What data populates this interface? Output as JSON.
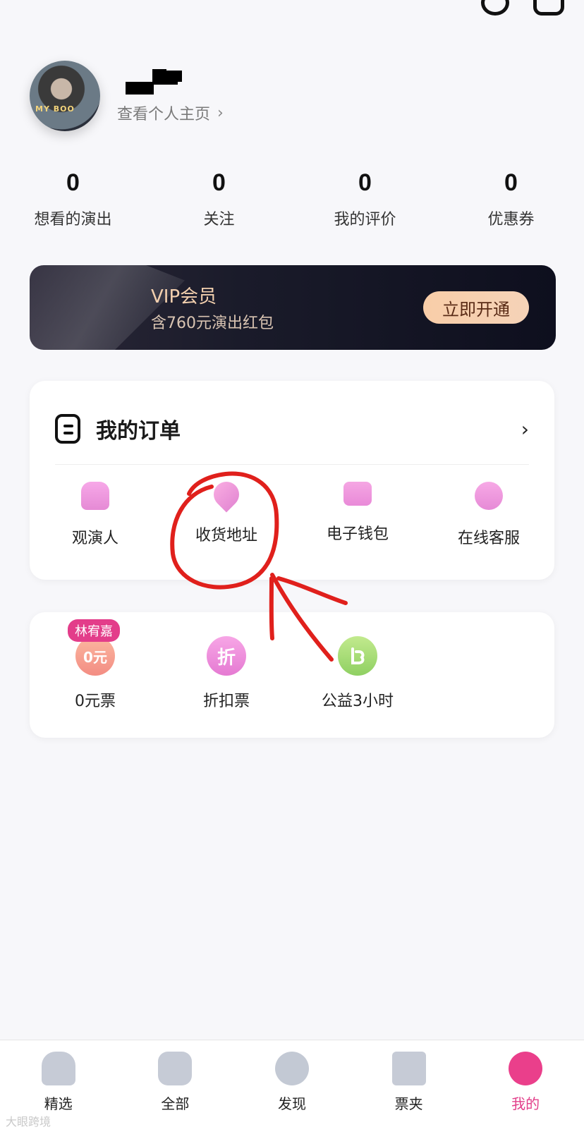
{
  "profile": {
    "view_home": "查看个人主页",
    "avatar_text": "MY BOO"
  },
  "stats": [
    {
      "value": "0",
      "label": "想看的演出"
    },
    {
      "value": "0",
      "label": "关注"
    },
    {
      "value": "0",
      "label": "我的评价"
    },
    {
      "value": "0",
      "label": "优惠券"
    }
  ],
  "vip": {
    "title": "VIP会员",
    "subtitle": "含760元演出红包",
    "button": "立即开通"
  },
  "orders": {
    "title": "我的订单",
    "items": [
      {
        "label": "观演人",
        "icon": "person-icon"
      },
      {
        "label": "收货地址",
        "icon": "location-pin-icon"
      },
      {
        "label": "电子钱包",
        "icon": "wallet-icon"
      },
      {
        "label": "在线客服",
        "icon": "customer-service-icon"
      }
    ]
  },
  "benefits": {
    "items": [
      {
        "label": "0元票",
        "icon_text": "0元",
        "badge": "林宥嘉"
      },
      {
        "label": "折扣票",
        "icon_text": "折"
      },
      {
        "label": "公益3小时",
        "icon_text": ""
      }
    ]
  },
  "tabbar": {
    "items": [
      {
        "label": "精选",
        "icon": "home-icon"
      },
      {
        "label": "全部",
        "icon": "category-icon"
      },
      {
        "label": "发现",
        "icon": "discover-icon"
      },
      {
        "label": "票夹",
        "icon": "ticket-icon"
      },
      {
        "label": "我的",
        "icon": "profile-icon"
      }
    ],
    "active_color": "#e23f8a"
  },
  "watermark": "大眼跨境",
  "colors": {
    "accent": "#e23f8a",
    "vip_bg": "#1a1b2a",
    "vip_button": "#f5d3b8",
    "annotation": "#e0201c"
  }
}
